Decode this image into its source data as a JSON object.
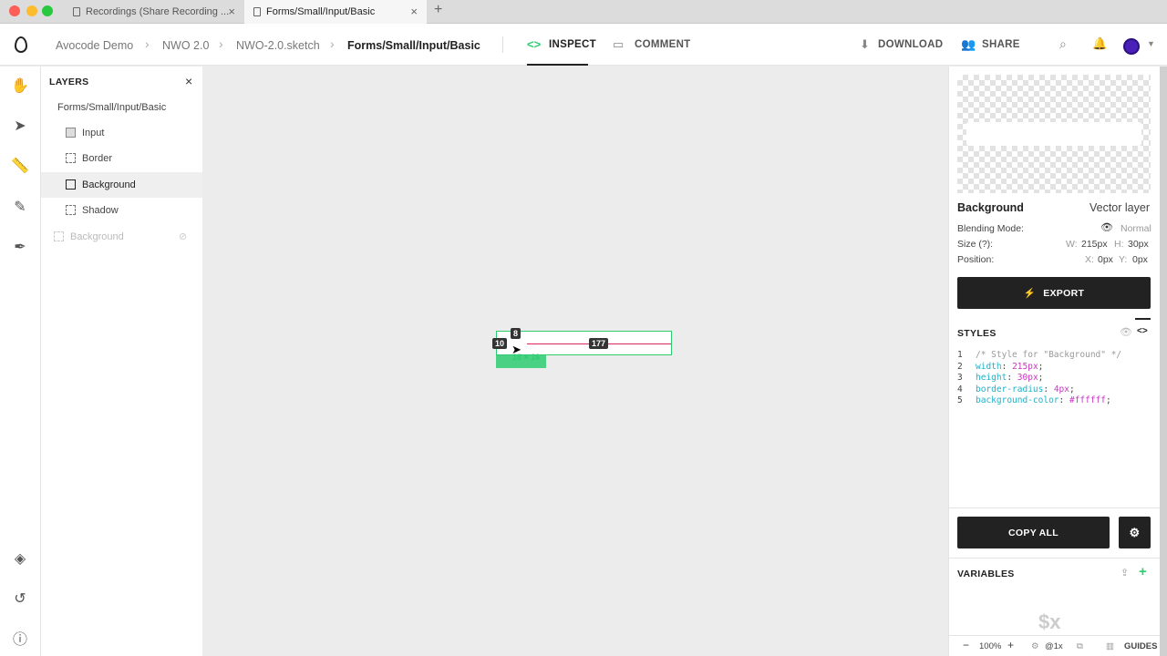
{
  "browser": {
    "tabs": [
      {
        "label": "Recordings (Share Recording ...",
        "active": false
      },
      {
        "label": "Forms/Small/Input/Basic",
        "active": true
      }
    ],
    "new_tab": "+",
    "close": "×"
  },
  "header": {
    "breadcrumb": [
      "Avocode Demo",
      "NWO 2.0",
      "NWO-2.0.sketch",
      "Forms/Small/Input/Basic"
    ],
    "separator": "›",
    "tabs": {
      "inspect": "INSPECT",
      "comment": "COMMENT"
    },
    "actions": {
      "download": "DOWNLOAD",
      "share": "SHARE"
    }
  },
  "layers": {
    "title": "LAYERS",
    "close": "×",
    "root": "Forms/Small/Input/Basic",
    "items": [
      {
        "label": "Input",
        "icon": "text-layer-icon"
      },
      {
        "label": "Border",
        "icon": "vector-layer-icon"
      },
      {
        "label": "Background",
        "icon": "vector-layer-icon",
        "selected": true
      },
      {
        "label": "Shadow",
        "icon": "vector-layer-icon"
      },
      {
        "label": "Background",
        "icon": "vector-layer-icon",
        "hidden": true
      }
    ]
  },
  "canvas": {
    "measure_top": "8",
    "measure_left": "10",
    "measure_right": "177",
    "size_label": "18 × 16"
  },
  "inspect": {
    "layer_name": "Background",
    "layer_type": "Vector layer",
    "blending_label": "Blending Mode:",
    "blending_value": "Normal",
    "size_label": "Size (?):",
    "w_key": "W:",
    "w_val": "215px",
    "h_key": "H:",
    "h_val": "30px",
    "position_label": "Position:",
    "x_key": "X:",
    "x_val": "0px",
    "y_key": "Y:",
    "y_val": "0px",
    "export": "EXPORT",
    "styles_title": "STYLES",
    "code": [
      {
        "n": "1",
        "comment": "/* Style for \"Background\" */"
      },
      {
        "n": "2",
        "prop": "width",
        "value": "215px"
      },
      {
        "n": "3",
        "prop": "height",
        "value": "30px"
      },
      {
        "n": "4",
        "prop": "border-radius",
        "value": "4px"
      },
      {
        "n": "5",
        "prop": "background-color",
        "value": "#ffffff"
      }
    ],
    "copy_all": "COPY ALL",
    "variables_title": "VARIABLES",
    "variables_placeholder": "$x",
    "zoom": "100%",
    "minus": "−",
    "plus": "+",
    "scale": "@1x",
    "guides": "GUIDES"
  },
  "colors": {
    "accent_green": "#2ecc71",
    "measure_red": "#e0245e",
    "code_prop": "#1fb0c8",
    "code_value": "#c936c2",
    "dark_button": "#222222",
    "avatar": "#4a21b8"
  }
}
